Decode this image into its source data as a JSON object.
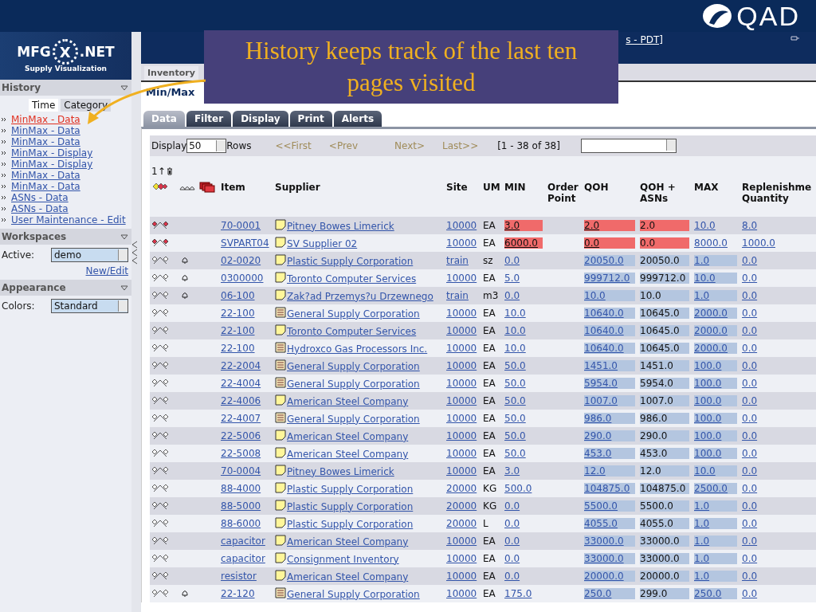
{
  "slide": {
    "logo": "QAD",
    "callout": "History keeps track of the last ten pages visited"
  },
  "app": {
    "logo_left": "MFG",
    "logo_mid": "X",
    "logo_right": ".NET",
    "logo_subtitle": "Supply Visualization",
    "header_link": "s - PDT]"
  },
  "top_tabs": [
    {
      "label": "Inventory",
      "selected": true
    }
  ],
  "sidebar": {
    "history": {
      "title": "History",
      "toggle": [
        {
          "label": "Time",
          "selected": true
        },
        {
          "label": "Category",
          "selected": false
        }
      ],
      "items": [
        {
          "label": "MinMax - Data",
          "selected": true
        },
        {
          "label": "MinMax - Data",
          "selected": false
        },
        {
          "label": "MinMax - Data",
          "selected": false
        },
        {
          "label": "MinMax - Display",
          "selected": false
        },
        {
          "label": "MinMax - Display",
          "selected": false
        },
        {
          "label": "MinMax - Data",
          "selected": false
        },
        {
          "label": "MinMax - Data",
          "selected": false
        },
        {
          "label": "ASNs - Data",
          "selected": false
        },
        {
          "label": "ASNs - Data",
          "selected": false
        },
        {
          "label": "User Maintenance - Edit",
          "selected": false
        }
      ]
    },
    "workspaces": {
      "title": "Workspaces",
      "label": "Active:",
      "value": "demo",
      "link": "New/Edit"
    },
    "appearance": {
      "title": "Appearance",
      "label": "Colors:",
      "value": "Standard"
    }
  },
  "page_title": "Min/Max",
  "tabs": [
    {
      "label": "Data",
      "selected": true
    },
    {
      "label": "Filter",
      "selected": false
    },
    {
      "label": "Display",
      "selected": false
    },
    {
      "label": "Print",
      "selected": false
    },
    {
      "label": "Alerts",
      "selected": false
    }
  ],
  "toolbar": {
    "display_label": "Display",
    "rows_value": "50",
    "rows_label": "Rows",
    "first": "<<First",
    "prev": "<Prev",
    "next": "Next>",
    "last": "Last>>",
    "range": "[1 - 38  of  38]"
  },
  "table": {
    "sort_indicator": "1↑",
    "columns": [
      "Item",
      "Supplier",
      "Site",
      "UM",
      "MIN",
      "Order Point",
      "QOH",
      "QOH + ASNs",
      "MAX",
      "Replenishme Quantity"
    ],
    "rows": [
      {
        "kind": "critical",
        "bell": false,
        "item": "70-0001",
        "supplier": {
          "kind": "note",
          "name": "Pitney Bowes Limerick"
        },
        "site": "10000",
        "um": "EA",
        "min": "3.0",
        "qoh": "2.0",
        "qoh_asns": "2.0",
        "max": "10.0",
        "replenish": "8.0"
      },
      {
        "kind": "critical",
        "bell": false,
        "item": "SVPART04",
        "supplier": {
          "kind": "note",
          "name": "SV Supplier 02"
        },
        "site": "10000",
        "um": "EA",
        "min": "6000.0",
        "qoh": "0.0",
        "qoh_asns": "0.0",
        "max": "8000.0",
        "replenish": "1000.0"
      },
      {
        "kind": "normal",
        "bell": true,
        "item": "02-0020",
        "supplier": {
          "kind": "note",
          "name": "Plastic Supply Corporation"
        },
        "site": "train",
        "um": "sz",
        "min": "0.0",
        "qoh": "20050.0",
        "qoh_asns": "20050.0",
        "max": "1.0",
        "replenish": "0.0"
      },
      {
        "kind": "normal",
        "bell": true,
        "item": "0300000",
        "supplier": {
          "kind": "note",
          "name": "Toronto Computer Services"
        },
        "site": "10000",
        "um": "EA",
        "min": "5.0",
        "qoh": "999712.0",
        "qoh_asns": "999712.0",
        "max": "10.0",
        "replenish": "0.0"
      },
      {
        "kind": "normal",
        "bell": true,
        "item": "06-100",
        "supplier": {
          "kind": "note",
          "name": "Zak?ad Przemys?u Drzewnego"
        },
        "site": "train",
        "um": "m3",
        "min": "0.0",
        "qoh": "10.0",
        "qoh_asns": "10.0",
        "max": "1.0",
        "replenish": "0.0"
      },
      {
        "kind": "normal",
        "bell": false,
        "item": "22-100",
        "supplier": {
          "kind": "list",
          "name": "General Supply Corporation"
        },
        "site": "10000",
        "um": "EA",
        "min": "10.0",
        "qoh": "10640.0",
        "qoh_asns": "10645.0",
        "max": "2000.0",
        "replenish": "0.0"
      },
      {
        "kind": "normal",
        "bell": false,
        "item": "22-100",
        "supplier": {
          "kind": "note",
          "name": "Toronto Computer Services"
        },
        "site": "10000",
        "um": "EA",
        "min": "10.0",
        "qoh": "10640.0",
        "qoh_asns": "10645.0",
        "max": "2000.0",
        "replenish": "0.0"
      },
      {
        "kind": "normal",
        "bell": false,
        "item": "22-100",
        "supplier": {
          "kind": "list",
          "name": "Hydroxco Gas Processors Inc."
        },
        "site": "10000",
        "um": "EA",
        "min": "10.0",
        "qoh": "10640.0",
        "qoh_asns": "10645.0",
        "max": "2000.0",
        "replenish": "0.0"
      },
      {
        "kind": "normal",
        "bell": false,
        "item": "22-2004",
        "supplier": {
          "kind": "list",
          "name": "General Supply Corporation"
        },
        "site": "10000",
        "um": "EA",
        "min": "50.0",
        "qoh": "1451.0",
        "qoh_asns": "1451.0",
        "max": "100.0",
        "replenish": "0.0"
      },
      {
        "kind": "normal",
        "bell": false,
        "item": "22-4004",
        "supplier": {
          "kind": "list",
          "name": "General Supply Corporation"
        },
        "site": "10000",
        "um": "EA",
        "min": "50.0",
        "qoh": "5954.0",
        "qoh_asns": "5954.0",
        "max": "100.0",
        "replenish": "0.0"
      },
      {
        "kind": "normal",
        "bell": false,
        "item": "22-4006",
        "supplier": {
          "kind": "note",
          "name": "American Steel Company"
        },
        "site": "10000",
        "um": "EA",
        "min": "50.0",
        "qoh": "1007.0",
        "qoh_asns": "1007.0",
        "max": "100.0",
        "replenish": "0.0"
      },
      {
        "kind": "normal",
        "bell": false,
        "item": "22-4007",
        "supplier": {
          "kind": "list",
          "name": "General Supply Corporation"
        },
        "site": "10000",
        "um": "EA",
        "min": "50.0",
        "qoh": "986.0",
        "qoh_asns": "986.0",
        "max": "100.0",
        "replenish": "0.0"
      },
      {
        "kind": "normal",
        "bell": false,
        "item": "22-5006",
        "supplier": {
          "kind": "note",
          "name": "American Steel Company"
        },
        "site": "10000",
        "um": "EA",
        "min": "50.0",
        "qoh": "290.0",
        "qoh_asns": "290.0",
        "max": "100.0",
        "replenish": "0.0"
      },
      {
        "kind": "normal",
        "bell": false,
        "item": "22-5008",
        "supplier": {
          "kind": "note",
          "name": "American Steel Company"
        },
        "site": "10000",
        "um": "EA",
        "min": "50.0",
        "qoh": "453.0",
        "qoh_asns": "453.0",
        "max": "100.0",
        "replenish": "0.0"
      },
      {
        "kind": "normal",
        "bell": false,
        "item": "70-0004",
        "supplier": {
          "kind": "note",
          "name": "Pitney Bowes Limerick"
        },
        "site": "10000",
        "um": "EA",
        "min": "3.0",
        "qoh": "12.0",
        "qoh_asns": "12.0",
        "max": "10.0",
        "replenish": "0.0"
      },
      {
        "kind": "normal",
        "bell": false,
        "item": "88-4000",
        "supplier": {
          "kind": "note",
          "name": "Plastic Supply Corporation"
        },
        "site": "20000",
        "um": "KG",
        "min": "500.0",
        "qoh": "104875.0",
        "qoh_asns": "104875.0",
        "max": "2500.0",
        "replenish": "0.0"
      },
      {
        "kind": "normal",
        "bell": false,
        "item": "88-5000",
        "supplier": {
          "kind": "note",
          "name": "Plastic Supply Corporation"
        },
        "site": "20000",
        "um": "KG",
        "min": "0.0",
        "qoh": "5500.0",
        "qoh_asns": "5500.0",
        "max": "1.0",
        "replenish": "0.0"
      },
      {
        "kind": "normal",
        "bell": false,
        "item": "88-6000",
        "supplier": {
          "kind": "note",
          "name": "Plastic Supply Corporation"
        },
        "site": "20000",
        "um": "L",
        "min": "0.0",
        "qoh": "4055.0",
        "qoh_asns": "4055.0",
        "max": "1.0",
        "replenish": "0.0"
      },
      {
        "kind": "normal",
        "bell": false,
        "item": "capacitor",
        "supplier": {
          "kind": "note",
          "name": "American Steel Company"
        },
        "site": "10000",
        "um": "EA",
        "min": "0.0",
        "qoh": "33000.0",
        "qoh_asns": "33000.0",
        "max": "1.0",
        "replenish": "0.0"
      },
      {
        "kind": "normal",
        "bell": false,
        "item": "capacitor",
        "supplier": {
          "kind": "note",
          "name": "Consignment Inventory"
        },
        "site": "10000",
        "um": "EA",
        "min": "0.0",
        "qoh": "33000.0",
        "qoh_asns": "33000.0",
        "max": "1.0",
        "replenish": "0.0"
      },
      {
        "kind": "normal",
        "bell": false,
        "item": "resistor",
        "supplier": {
          "kind": "note",
          "name": "American Steel Company"
        },
        "site": "10000",
        "um": "EA",
        "min": "0.0",
        "qoh": "20000.0",
        "qoh_asns": "20000.0",
        "max": "1.0",
        "replenish": "0.0"
      },
      {
        "kind": "normal",
        "bell": true,
        "item": "22-120",
        "supplier": {
          "kind": "list",
          "name": "General Supply Corporation"
        },
        "site": "10000",
        "um": "EA",
        "min": "175.0",
        "qoh": "250.0",
        "qoh_asns": "299.0",
        "max": "250.0",
        "replenish": "0.0"
      }
    ]
  }
}
